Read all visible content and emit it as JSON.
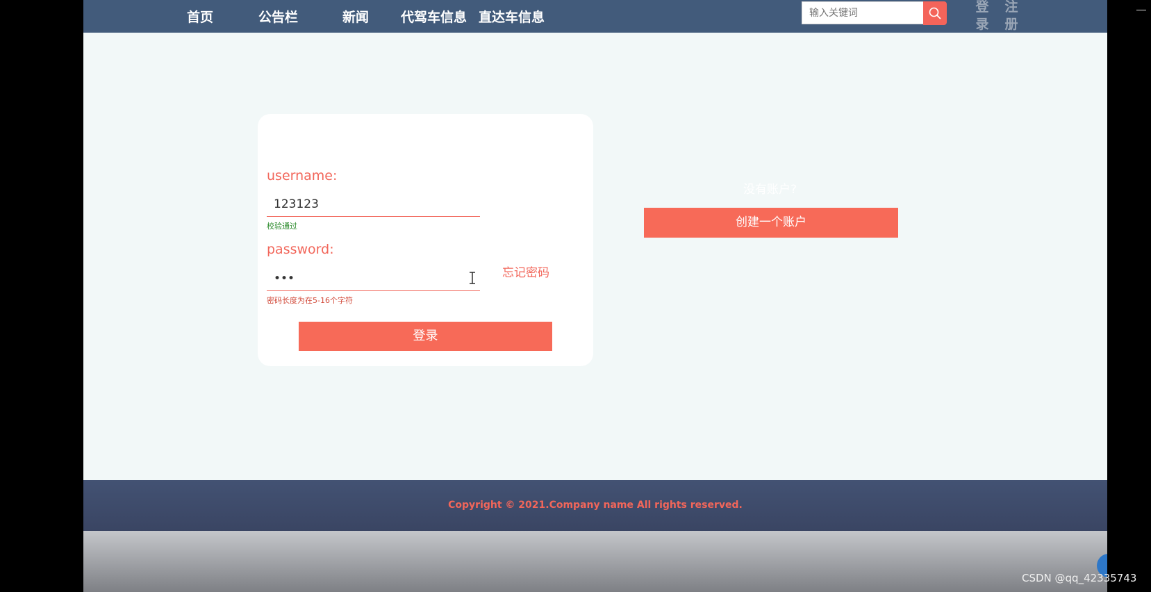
{
  "nav": {
    "items": [
      "首页",
      "公告栏",
      "新闻",
      "代驾车信息",
      "直达车信息"
    ]
  },
  "search": {
    "placeholder": "输入关键词",
    "icon": "search-icon"
  },
  "auth": {
    "login": [
      "登",
      "录"
    ],
    "register": [
      "注",
      "册"
    ]
  },
  "login_form": {
    "username_label": "username:",
    "username_value": "123123",
    "username_hint": "校验通过",
    "password_label": "password:",
    "password_value": "•••",
    "password_hint": "密码长度为在5-16个字符",
    "forgot_label": "忘记密码",
    "submit_label": "登录"
  },
  "register_panel": {
    "prompt": "没有账户?",
    "create_label": "创建一个账户"
  },
  "footer": {
    "copyright": "Copyright © 2021.Company name All rights reserved."
  },
  "watermark": "CSDN @qq_42335743",
  "colors": {
    "header_bg": "#425b7b",
    "accent": "#f76a58",
    "success_hint": "#2a8a2a",
    "error_hint": "#d24a3a"
  }
}
